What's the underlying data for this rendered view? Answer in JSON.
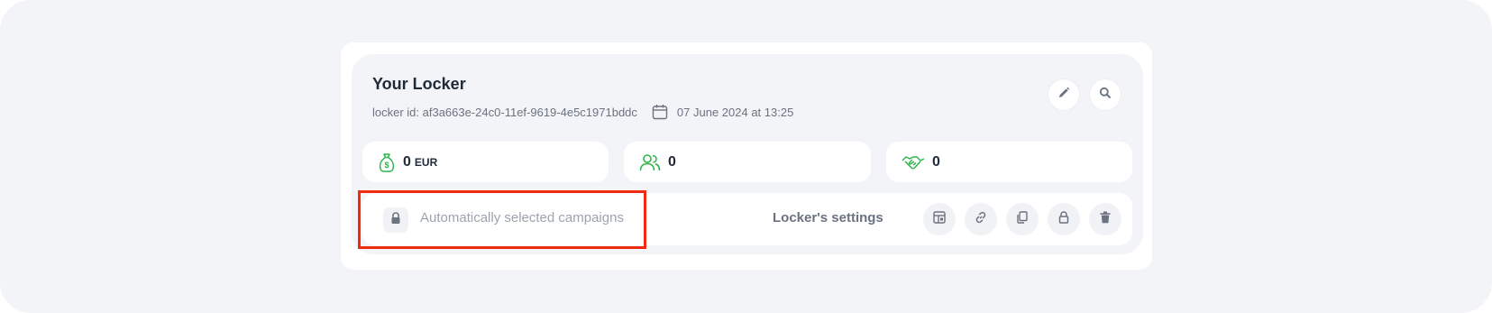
{
  "locker": {
    "title": "Your Locker",
    "id_text": "locker id: af3a663e-24c0-11ef-9619-4e5c1971bddc",
    "date_text": "07 June 2024 at 13:25"
  },
  "stats": [
    {
      "icon": "money-bag-icon",
      "value": "0",
      "unit": "EUR"
    },
    {
      "icon": "users-icon",
      "value": "0",
      "unit": ""
    },
    {
      "icon": "handshake-icon",
      "value": "0",
      "unit": ""
    }
  ],
  "bottom": {
    "auto_campaigns_label": "Automatically selected campaigns",
    "settings_label": "Locker's settings"
  },
  "colors": {
    "accent_green": "#2fb34a",
    "highlight_red": "#ef2b12",
    "icon_gray": "#6b7280"
  }
}
